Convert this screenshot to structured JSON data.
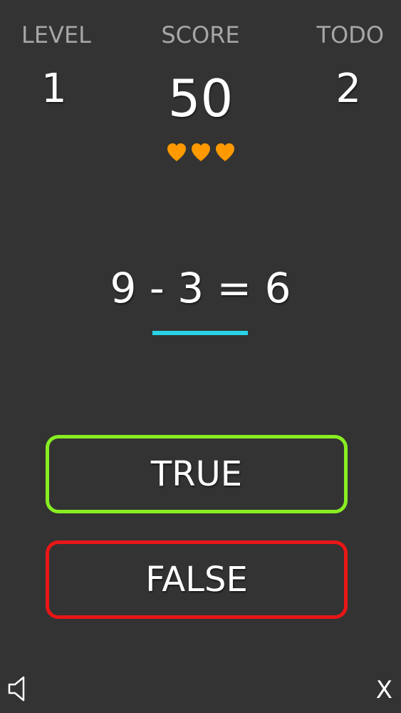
{
  "stats": {
    "level_label": "LEVEL",
    "level_value": "1",
    "score_label": "SCORE",
    "score_value": "50",
    "todo_label": "TODO",
    "todo_value": "2"
  },
  "lives": {
    "count": 3,
    "icon": "heart-icon",
    "color": "#ff9900"
  },
  "question": {
    "equation": "9 - 3 = 6",
    "underline_color": "#29d3e6"
  },
  "answers": {
    "true_label": "TRUE",
    "true_color": "#88ee22",
    "false_label": "FALSE",
    "false_color": "#e81616"
  },
  "controls": {
    "sound_icon": "speaker-icon",
    "close_label": "X"
  }
}
